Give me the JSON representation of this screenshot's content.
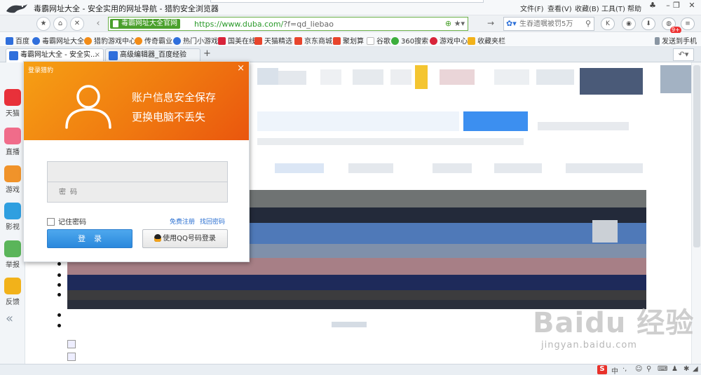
{
  "window": {
    "title": "毒霸网址大全 - 安全实用的网址导航 - 猎豹安全浏览器",
    "menu": [
      "文件(F)",
      "查看(V)",
      "收藏(B)",
      "工具(T)",
      "帮助"
    ]
  },
  "navbar": {
    "secure_label": "毒霸网址大全官网",
    "url_scheme": "https://www.duba.com/",
    "url_rest": "?f=qd_liebao",
    "search_placeholder": "生吞遗嘱被罚5万",
    "badge": "9+"
  },
  "bookmarks": [
    {
      "label": "百度",
      "color": "#2f6fdc"
    },
    {
      "label": "毒霸网址大全",
      "color": "#2f6fdc"
    },
    {
      "label": "猎豹游戏中心",
      "color": "#f28c18"
    },
    {
      "label": "传奇霸业",
      "color": "#f28c18"
    },
    {
      "label": "热门小游戏",
      "color": "#2f6fdc"
    },
    {
      "label": "国美在线",
      "color": "#d8243a"
    },
    {
      "label": "天猫精选",
      "color": "#e8452c"
    },
    {
      "label": "京东商城",
      "color": "#e8452c"
    },
    {
      "label": "聚划算",
      "color": "#e8452c"
    },
    {
      "label": "谷歌",
      "color": "#999999"
    },
    {
      "label": "360搜索",
      "color": "#3cae3c"
    },
    {
      "label": "游戏中心",
      "color": "#d8243a"
    },
    {
      "label": "收藏夹栏",
      "color": "#f2b21a"
    }
  ],
  "bookmark_right": "发送到手机",
  "tabs": [
    {
      "label": "毒霸网址大全 - 安全实...",
      "color": "#2f6fdc"
    },
    {
      "label": "高级编辑器_百度经验",
      "color": "#2f6fdc"
    }
  ],
  "sidebar": [
    {
      "label": "天猫",
      "color": "#e8313a"
    },
    {
      "label": "直播",
      "color": "#f06c8a"
    },
    {
      "label": "游戏",
      "color": "#f0932a"
    },
    {
      "label": "影视",
      "color": "#2f9fe0"
    },
    {
      "label": "举报",
      "color": "#5ab55a"
    },
    {
      "label": "反馈",
      "color": "#f2b21a"
    }
  ],
  "login": {
    "title": "登录猎豹",
    "slogan1": "账户信息安全保存",
    "slogan2": "更换电脑不丢失",
    "username_placeholder": "",
    "password_placeholder": "密码",
    "remember_label": "记住密码",
    "register_link": "免费注册",
    "forgot_link": "找回密码",
    "login_button": "登录",
    "qq_button": "使用QQ号码登录"
  },
  "statusbar": {
    "ime_label": "中"
  },
  "watermark": {
    "brand": "Baidu 经验",
    "url": "jingyan.baidu.com"
  },
  "colors": {
    "accent_orange": "#f07a10",
    "button_blue": "#2a88dc",
    "secure_green": "#4aa02c"
  }
}
